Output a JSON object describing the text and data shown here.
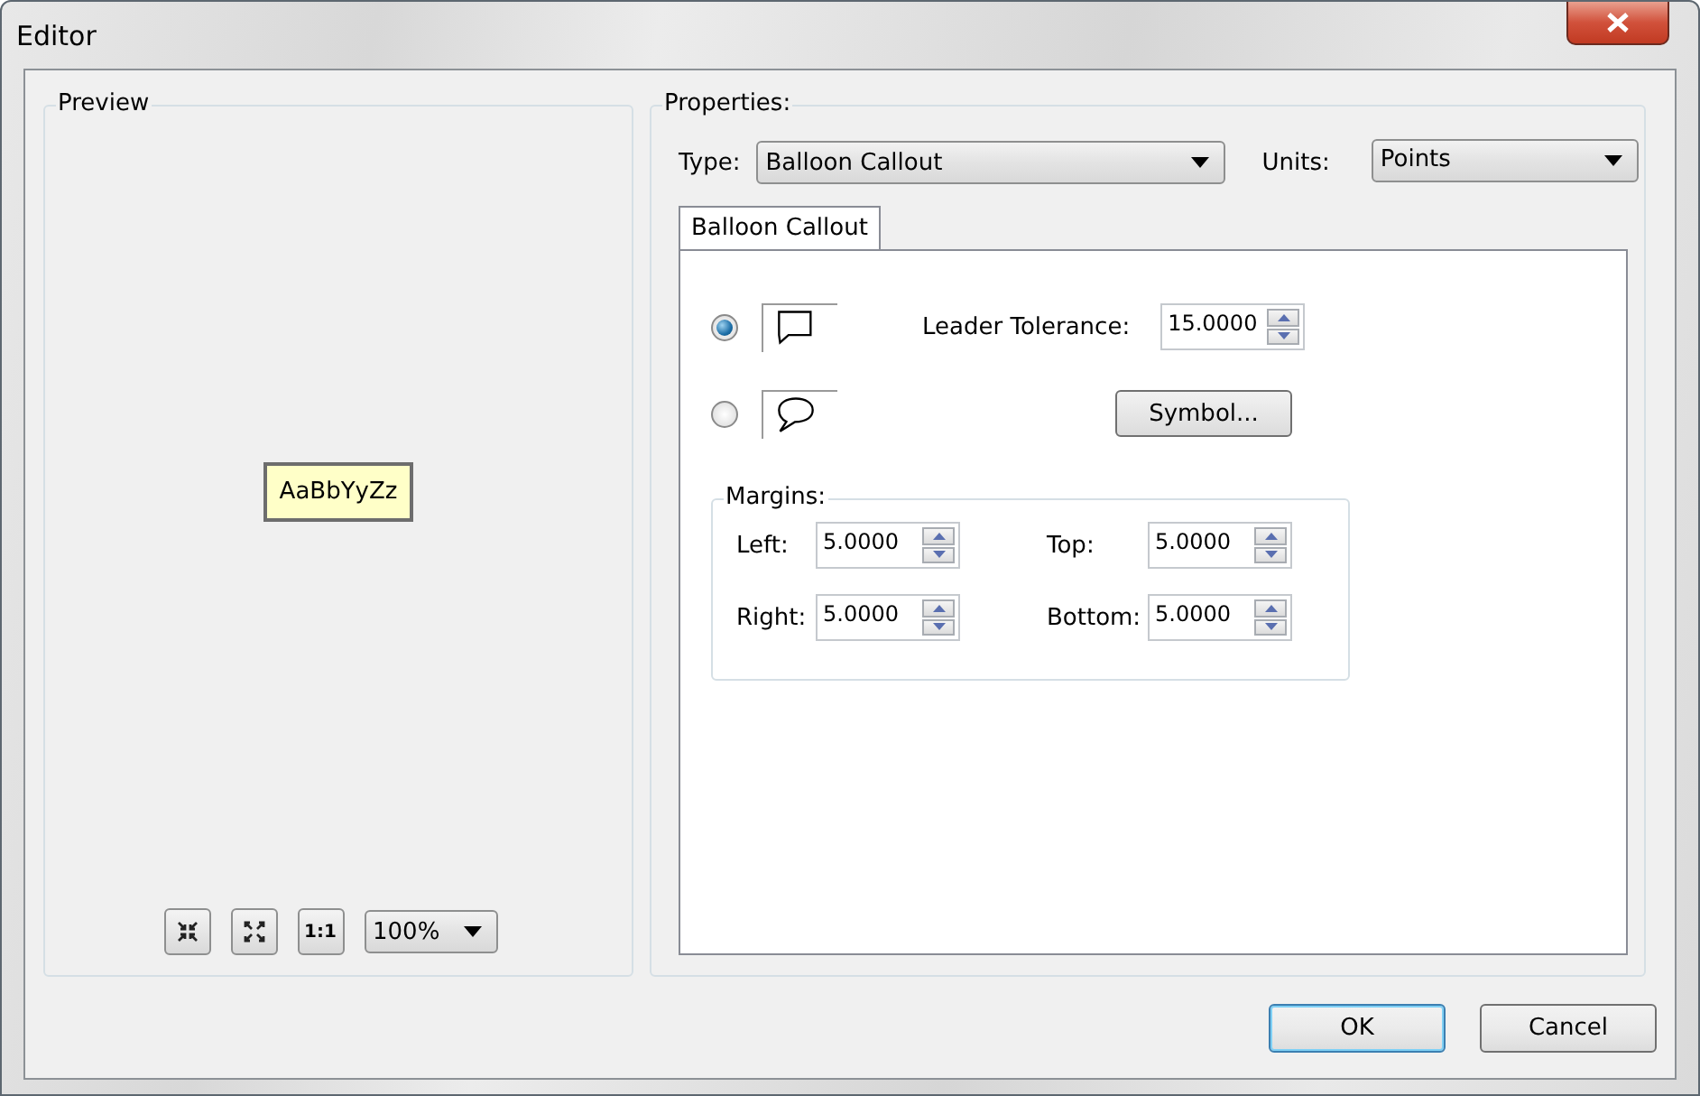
{
  "window": {
    "title": "Editor"
  },
  "preview": {
    "title": "Preview",
    "sample_text": "AaBbYyZz",
    "ratio_button": "1:1",
    "zoom": "100%"
  },
  "properties": {
    "title": "Properties:",
    "type": {
      "label": "Type:",
      "value": "Balloon Callout"
    },
    "units": {
      "label": "Units:",
      "value": "Points"
    },
    "tabs": [
      {
        "label": "Balloon Callout",
        "selected": true
      }
    ],
    "styles": [
      {
        "kind": "rectangle",
        "selected": true
      },
      {
        "kind": "rounded",
        "selected": false
      }
    ],
    "leader_tolerance": {
      "label": "Leader Tolerance:",
      "value": "15.0000"
    },
    "symbol_button": "Symbol...",
    "margins": {
      "title": "Margins:",
      "fields": [
        {
          "label": "Left:",
          "value": "5.0000"
        },
        {
          "label": "Top:",
          "value": "5.0000"
        },
        {
          "label": "Right:",
          "value": "5.0000"
        },
        {
          "label": "Bottom:",
          "value": "5.0000"
        }
      ]
    }
  },
  "buttons": [
    {
      "label": "OK",
      "default": true
    },
    {
      "label": "Cancel",
      "default": false
    }
  ]
}
